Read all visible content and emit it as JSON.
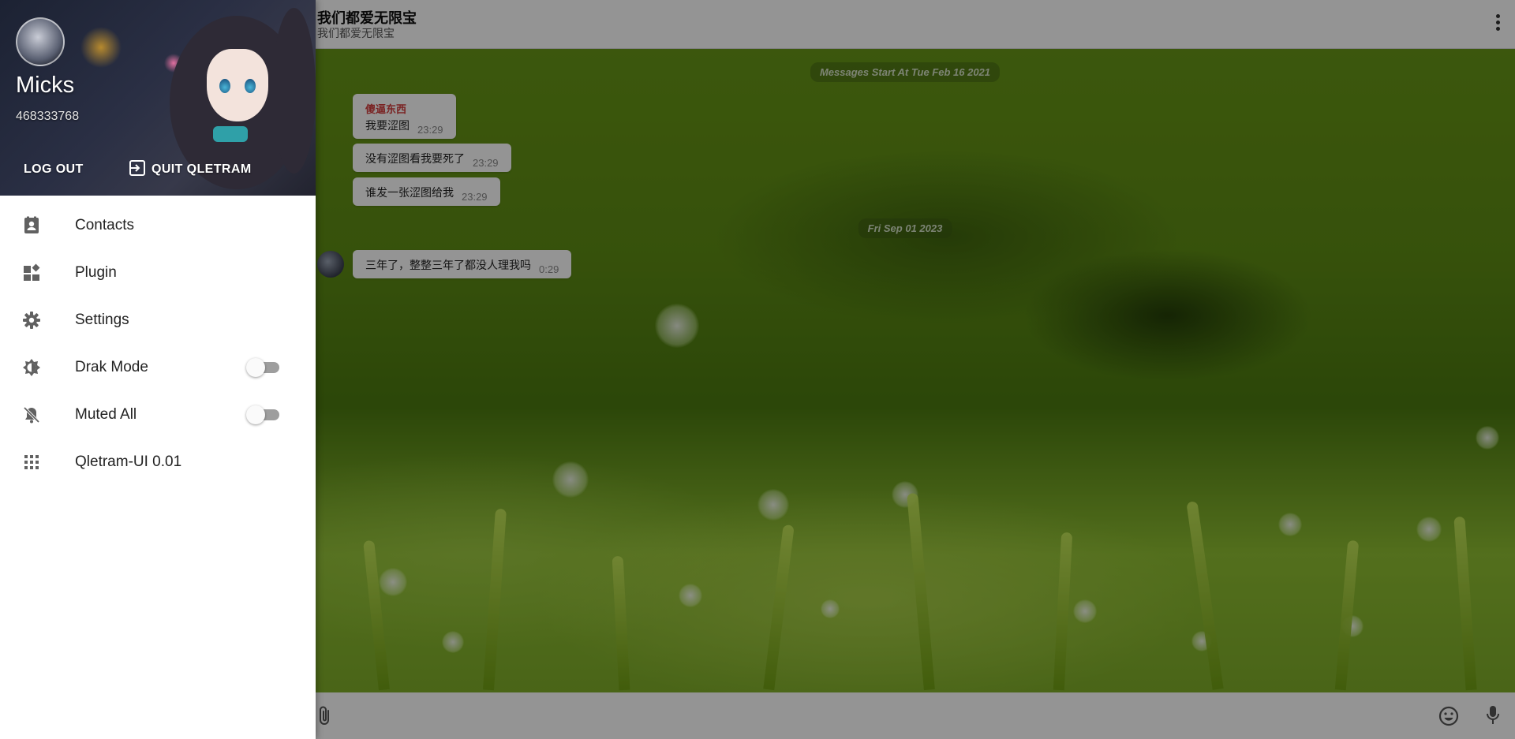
{
  "chat": {
    "title": "我们都爱无限宝",
    "subtitle": "我们都爱无限宝",
    "date_dividers": [
      "Messages Start At Tue Feb 16 2021",
      "Fri Sep 01 2023"
    ],
    "messages": [
      {
        "sender": "傻逼东西",
        "text": "我要涩图",
        "time": "23:29"
      },
      {
        "sender": "",
        "text": "没有涩图看我要死了",
        "time": "23:29"
      },
      {
        "sender": "",
        "text": "谁发一张涩图给我",
        "time": "23:29"
      },
      {
        "sender": "",
        "text": "三年了，整整三年了都没人理我吗",
        "time": "0:29"
      }
    ],
    "menu_icon": "more-vert-icon",
    "composer_icons": [
      "paperclip-icon",
      "emoji-icon",
      "mic-icon"
    ]
  },
  "drawer": {
    "user": {
      "name": "Micks",
      "id": "468333768"
    },
    "logout_label": "LOG OUT",
    "quit_label": "QUIT QLETRAM",
    "items": [
      {
        "label": "Contacts",
        "icon": "contacts-icon"
      },
      {
        "label": "Plugin",
        "icon": "widgets-icon"
      },
      {
        "label": "Settings",
        "icon": "gear-icon"
      },
      {
        "label": "Drak Mode",
        "icon": "brightness-icon",
        "toggle": false
      },
      {
        "label": "Muted All",
        "icon": "bell-off-icon",
        "toggle": false
      },
      {
        "label": "Qletram-UI 0.01",
        "icon": "apps-grid-icon"
      }
    ]
  }
}
